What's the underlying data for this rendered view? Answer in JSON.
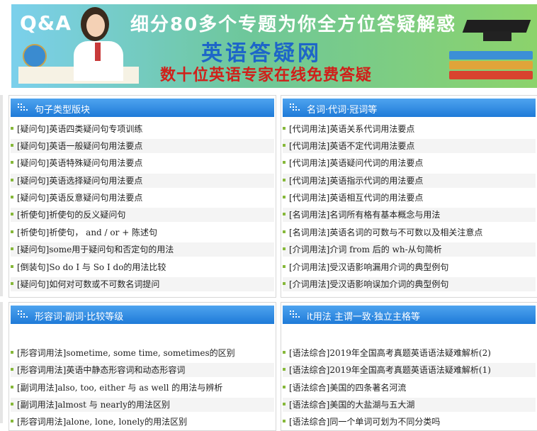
{
  "banner": {
    "qa": "Q&A",
    "line1": "细分80多个专题为你全方位答疑解惑",
    "line2": "英语答疑网",
    "line3": "数十位英语专家在线免费答疑"
  },
  "panels": [
    {
      "title": "句子类型版块",
      "items": [
        "[疑问句]英语四类疑问句专项训练",
        "[疑问句]英语一般疑问句用法要点",
        "[疑问句]英语特殊疑问句用法要点",
        "[疑问句]英语选择疑问句用法要点",
        "[疑问句]英语反意疑问句用法要点",
        "[祈使句]祈使句的反义疑问句",
        "[祈使句]祈使句， and / or + 陈述句",
        "[疑问句]some用于疑问句和否定句的用法",
        "[倒装句]So do I 与 So I do的用法比较",
        "[疑问句]如何对可数或不可数名词提问"
      ]
    },
    {
      "title": "名词·代词·冠词等",
      "items": [
        "[代词用法]英语关系代词用法要点",
        "[代词用法]英语不定代词用法要点",
        "[代词用法]英语疑问代词的用法要点",
        "[代词用法]英语指示代词的用法要点",
        "[代词用法]英语相互代词的用法要点",
        "[名词用法]名词所有格有基本概念与用法",
        "[名词用法]英语名词的可数与不可数以及相关注意点",
        "[介词用法]介词 from 后的 wh-从句简析",
        "[介词用法]受汉语影响漏用介词的典型例句",
        "[介词用法]受汉语影响误加介词的典型例句"
      ]
    },
    {
      "title": "形容词·副词·比较等级",
      "items": [
        "[形容词用法]sometime, some time, sometimes的区别",
        "[形容词用法]英语中静态形容词和动态形容词",
        "[副词用法]also, too, either 与 as well 的用法与辨析",
        "[副词用法]almost 与 nearly的用法区别",
        "[形容词用法]alone, lone, lonely的用法区别"
      ]
    },
    {
      "title": "it用法 主谓一致·独立主格等",
      "items": [
        "[语法综合]2019年全国高考真题英语语法疑难解析(2)",
        "[语法综合]2019年全国高考真题英语语法疑难解析(1)",
        "[语法综合]美国的四条著名河流",
        "[语法综合]美国的大盐湖与五大湖",
        "[语法综合]同一个单词可划为不同分类吗"
      ]
    }
  ]
}
